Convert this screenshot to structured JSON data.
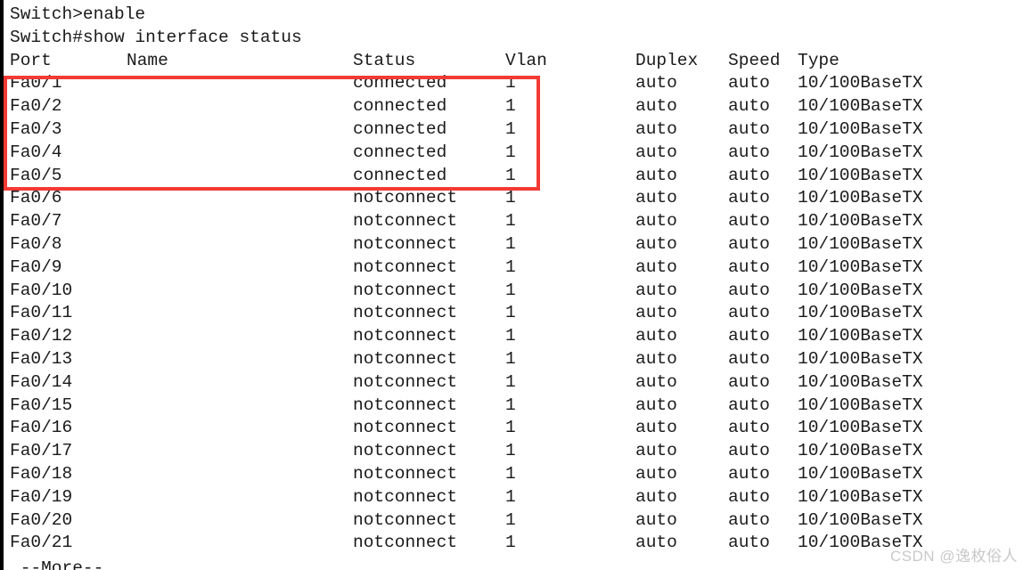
{
  "terminal": {
    "prompt_lines": [
      "Switch>enable",
      "Switch#show interface status"
    ],
    "headers": {
      "port": "Port",
      "name": "Name",
      "status": "Status",
      "vlan": "Vlan",
      "duplex": "Duplex",
      "speed": "Speed",
      "type": "Type"
    },
    "rows": [
      {
        "port": "Fa0/1",
        "name": "",
        "status": "connected",
        "vlan": "1",
        "duplex": "auto",
        "speed": "auto",
        "type": "10/100BaseTX"
      },
      {
        "port": "Fa0/2",
        "name": "",
        "status": "connected",
        "vlan": "1",
        "duplex": "auto",
        "speed": "auto",
        "type": "10/100BaseTX"
      },
      {
        "port": "Fa0/3",
        "name": "",
        "status": "connected",
        "vlan": "1",
        "duplex": "auto",
        "speed": "auto",
        "type": "10/100BaseTX"
      },
      {
        "port": "Fa0/4",
        "name": "",
        "status": "connected",
        "vlan": "1",
        "duplex": "auto",
        "speed": "auto",
        "type": "10/100BaseTX"
      },
      {
        "port": "Fa0/5",
        "name": "",
        "status": "connected",
        "vlan": "1",
        "duplex": "auto",
        "speed": "auto",
        "type": "10/100BaseTX"
      },
      {
        "port": "Fa0/6",
        "name": "",
        "status": "notconnect",
        "vlan": "1",
        "duplex": "auto",
        "speed": "auto",
        "type": "10/100BaseTX"
      },
      {
        "port": "Fa0/7",
        "name": "",
        "status": "notconnect",
        "vlan": "1",
        "duplex": "auto",
        "speed": "auto",
        "type": "10/100BaseTX"
      },
      {
        "port": "Fa0/8",
        "name": "",
        "status": "notconnect",
        "vlan": "1",
        "duplex": "auto",
        "speed": "auto",
        "type": "10/100BaseTX"
      },
      {
        "port": "Fa0/9",
        "name": "",
        "status": "notconnect",
        "vlan": "1",
        "duplex": "auto",
        "speed": "auto",
        "type": "10/100BaseTX"
      },
      {
        "port": "Fa0/10",
        "name": "",
        "status": "notconnect",
        "vlan": "1",
        "duplex": "auto",
        "speed": "auto",
        "type": "10/100BaseTX"
      },
      {
        "port": "Fa0/11",
        "name": "",
        "status": "notconnect",
        "vlan": "1",
        "duplex": "auto",
        "speed": "auto",
        "type": "10/100BaseTX"
      },
      {
        "port": "Fa0/12",
        "name": "",
        "status": "notconnect",
        "vlan": "1",
        "duplex": "auto",
        "speed": "auto",
        "type": "10/100BaseTX"
      },
      {
        "port": "Fa0/13",
        "name": "",
        "status": "notconnect",
        "vlan": "1",
        "duplex": "auto",
        "speed": "auto",
        "type": "10/100BaseTX"
      },
      {
        "port": "Fa0/14",
        "name": "",
        "status": "notconnect",
        "vlan": "1",
        "duplex": "auto",
        "speed": "auto",
        "type": "10/100BaseTX"
      },
      {
        "port": "Fa0/15",
        "name": "",
        "status": "notconnect",
        "vlan": "1",
        "duplex": "auto",
        "speed": "auto",
        "type": "10/100BaseTX"
      },
      {
        "port": "Fa0/16",
        "name": "",
        "status": "notconnect",
        "vlan": "1",
        "duplex": "auto",
        "speed": "auto",
        "type": "10/100BaseTX"
      },
      {
        "port": "Fa0/17",
        "name": "",
        "status": "notconnect",
        "vlan": "1",
        "duplex": "auto",
        "speed": "auto",
        "type": "10/100BaseTX"
      },
      {
        "port": "Fa0/18",
        "name": "",
        "status": "notconnect",
        "vlan": "1",
        "duplex": "auto",
        "speed": "auto",
        "type": "10/100BaseTX"
      },
      {
        "port": "Fa0/19",
        "name": "",
        "status": "notconnect",
        "vlan": "1",
        "duplex": "auto",
        "speed": "auto",
        "type": "10/100BaseTX"
      },
      {
        "port": "Fa0/20",
        "name": "",
        "status": "notconnect",
        "vlan": "1",
        "duplex": "auto",
        "speed": "auto",
        "type": "10/100BaseTX"
      },
      {
        "port": "Fa0/21",
        "name": "",
        "status": "notconnect",
        "vlan": "1",
        "duplex": "auto",
        "speed": "auto",
        "type": "10/100BaseTX"
      }
    ],
    "more_prompt": " --More--"
  },
  "annotation": {
    "highlight_color": "#f43a35",
    "highlight_rows": 5,
    "highlight_note": "red rectangle around Fa0/1 - Fa0/5 connected ports"
  },
  "watermark": {
    "text": "CSDN @逸枚俗人",
    "color": "#c9c9c9"
  },
  "colors": {
    "background": "#ffffff",
    "text": "#1a1a1a",
    "window_edge": "#000000"
  }
}
